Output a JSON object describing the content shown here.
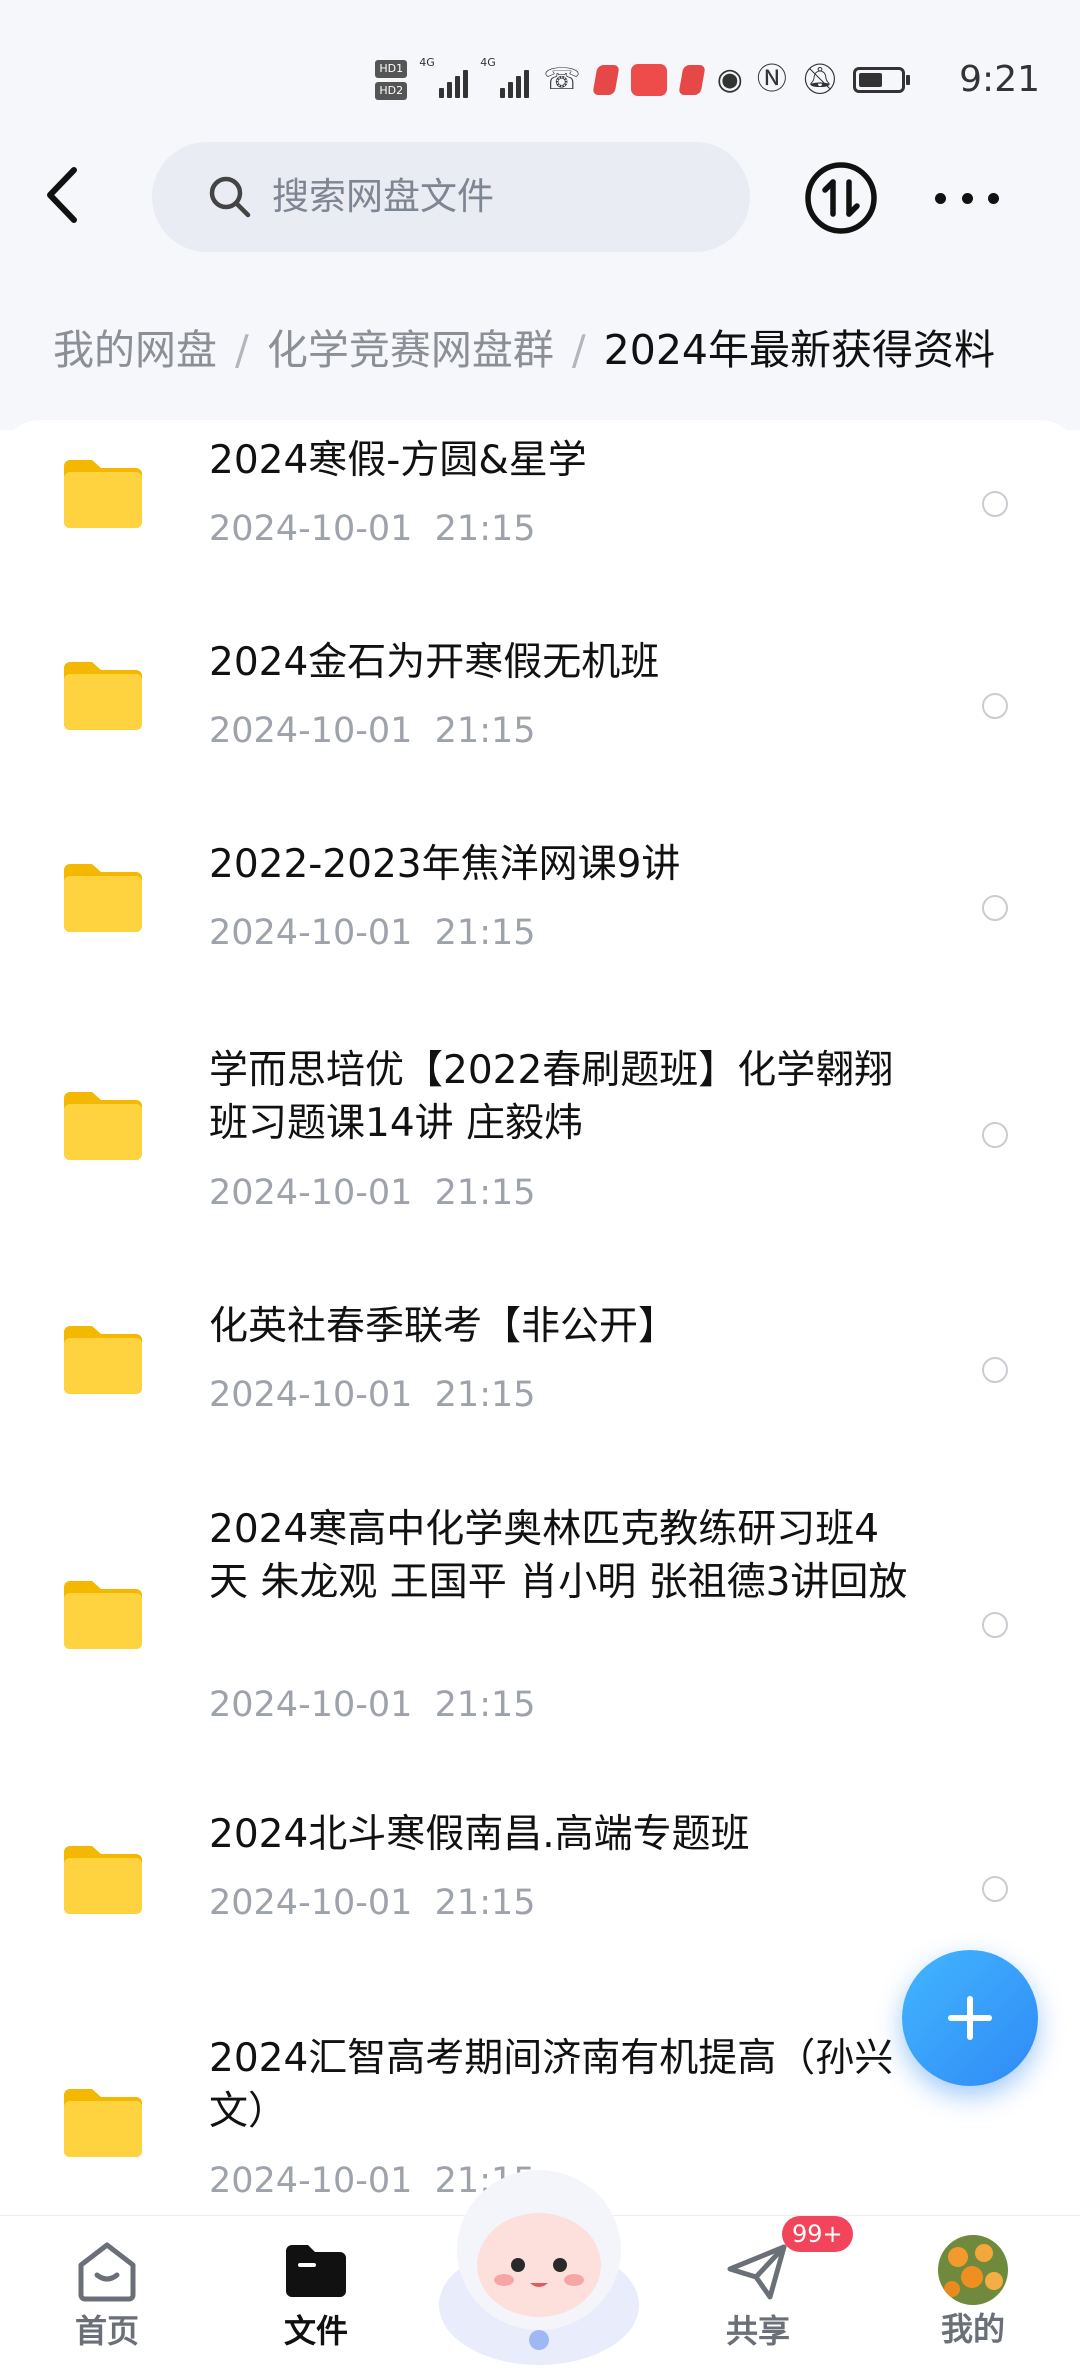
{
  "status_bar": {
    "time": "9:21",
    "sim1": "HD1",
    "sim2": "HD2",
    "net1": "4G",
    "net2": "4G",
    "battery_level": 0.62
  },
  "header": {
    "search_placeholder": "搜索网盘文件",
    "icons": [
      "back-arrow-icon",
      "search-icon",
      "transfer-icon",
      "more-icon"
    ]
  },
  "breadcrumb": [
    {
      "label": "我的网盘"
    },
    {
      "label": "化学竞赛网盘群"
    },
    {
      "label": "2024年最新获得资料"
    }
  ],
  "breadcrumb_separator": "/",
  "files": [
    {
      "name": "2024寒假-方圆&星学",
      "date": "2024-10-01  21:15"
    },
    {
      "name": "2024金石为开寒假无机班",
      "date": "2024-10-01  21:15"
    },
    {
      "name": "2022-2023年焦洋网课9讲",
      "date": "2024-10-01  21:15"
    },
    {
      "name": "学而思培优【2022春刷题班】化学翱翔班习题课14讲 庄毅炜",
      "date": "2024-10-01  21:15"
    },
    {
      "name": "化英社春季联考【非公开】",
      "date": "2024-10-01  21:15"
    },
    {
      "name": "2024寒高中化学奥林匹克教练研习班4天 朱龙观 王国平 肖小明 张祖德3讲回放",
      "date": "2024-10-01  21:15"
    },
    {
      "name": "2024北斗寒假南昌.高端专题班",
      "date": "2024-10-01  21:15"
    },
    {
      "name": "2024汇智高考期间济南有机提高（孙兴文）",
      "date": "2024-10-01  21:15"
    }
  ],
  "bottom_nav": [
    {
      "label": "首页",
      "icon": "home-icon"
    },
    {
      "label": "文件",
      "icon": "folder-icon",
      "active": true
    },
    {
      "label": "共享",
      "icon": "paper-plane-icon",
      "badge": "99+"
    },
    {
      "label": "我的",
      "icon": "avatar-icon"
    }
  ],
  "colors": {
    "accent": "#2f8af5",
    "folder": "#ffcc33",
    "badge": "#f2445b"
  }
}
